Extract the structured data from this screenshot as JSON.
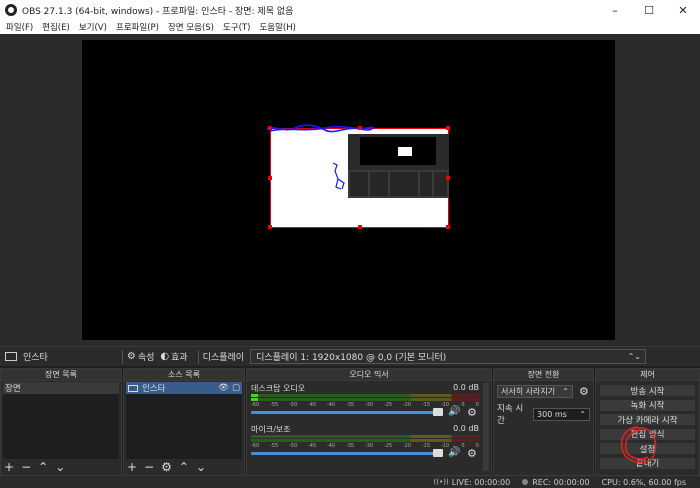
{
  "window": {
    "title": "OBS 27.1.3 (64-bit, windows) - 프로파일: 인스타 - 장면: 제목 없음",
    "minimize": "–",
    "maximize": "☐",
    "close": "✕"
  },
  "menu": [
    "파일(F)",
    "편집(E)",
    "보기(V)",
    "프로파일(P)",
    "장면 모음(S)",
    "도구(T)",
    "도움말(H)"
  ],
  "source_toolbar": {
    "source_name": "인스타",
    "properties_label": "속성",
    "filters_label": "효과",
    "display_label": "디스플레이",
    "display_value": "디스플레이 1: 1920x1080 @ 0,0 (기본 모니터)"
  },
  "scenes": {
    "title": "장면 목록",
    "items": [
      "장면"
    ]
  },
  "sources": {
    "title": "소스 목록",
    "items": [
      "인스타"
    ]
  },
  "mixer": {
    "title": "오디오 믹서",
    "channels": [
      {
        "name": "데스크탑 오디오",
        "level": "0.0 dB",
        "meter_fill": 0.03
      },
      {
        "name": "마이크/보조",
        "level": "0.0 dB",
        "meter_fill": 0.0
      }
    ],
    "scale": [
      "-60",
      "-55",
      "-50",
      "-45",
      "-40",
      "-35",
      "-30",
      "-25",
      "-20",
      "-15",
      "-10",
      "-5",
      "0"
    ]
  },
  "transitions": {
    "title": "장면 전환",
    "selected": "서서히 사라지기",
    "duration_label": "지속 시간",
    "duration_value": "300 ms"
  },
  "controls": {
    "title": "제어",
    "buttons": [
      "방송 시작",
      "녹화 시작",
      "가상 카메라 시작",
      "편집 방식",
      "설정",
      "끝내기"
    ]
  },
  "status": {
    "live": "LIVE: 00:00:00",
    "rec": "REC: 00:00:00",
    "cpu": "CPU: 0.6%, 60.00 fps"
  },
  "colors": {
    "selection_red": "#ee0000",
    "source_selected": "#3a5c8c",
    "annotation_red": "#e02020",
    "scribble_blue": "#1a1aff"
  }
}
